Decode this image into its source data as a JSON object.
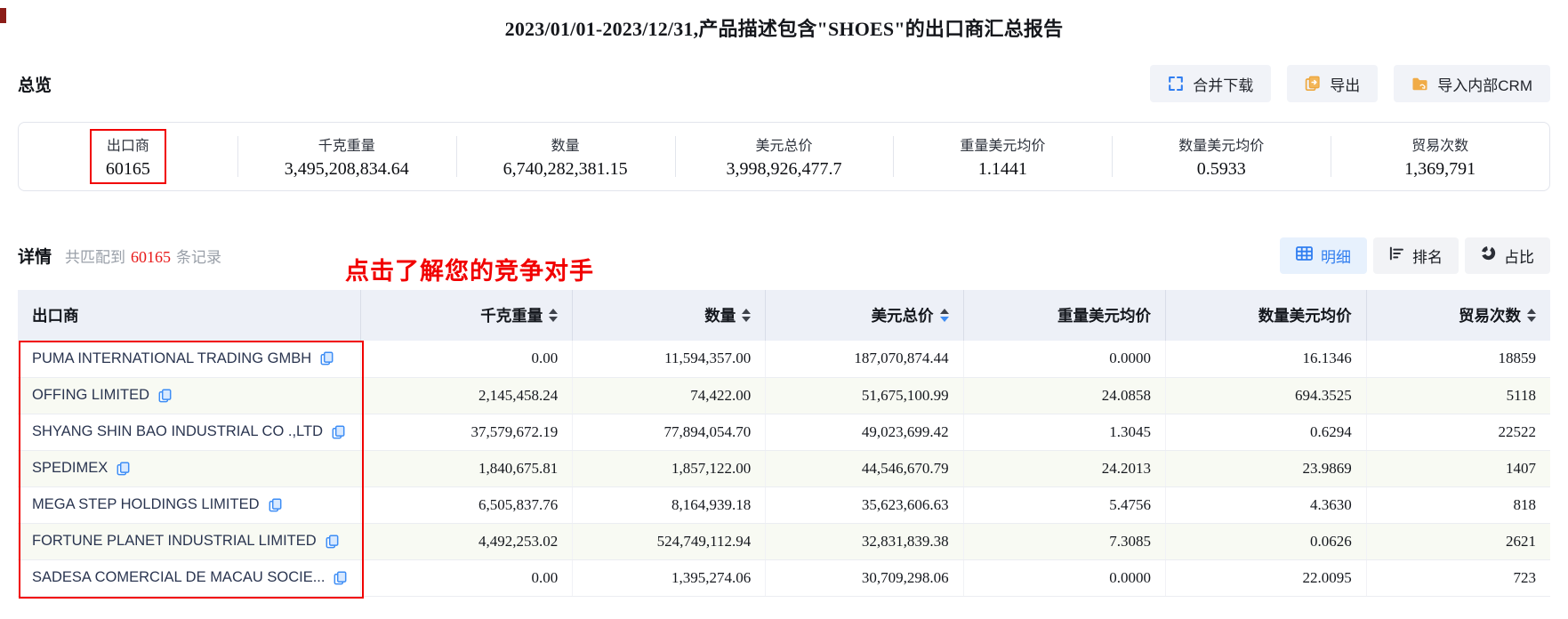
{
  "title": "2023/01/01-2023/12/31,产品描述包含\"SHOES\"的出口商汇总报告",
  "overview": {
    "heading": "总览",
    "actions": [
      {
        "label": "合并下载",
        "icon": "merge-download-icon"
      },
      {
        "label": "导出",
        "icon": "export-icon"
      },
      {
        "label": "导入内部CRM",
        "icon": "import-crm-icon"
      }
    ],
    "stats": [
      {
        "label": "出口商",
        "value": "60165",
        "highlighted": true
      },
      {
        "label": "千克重量",
        "value": "3,495,208,834.64",
        "highlighted": false
      },
      {
        "label": "数量",
        "value": "6,740,282,381.15",
        "highlighted": false
      },
      {
        "label": "美元总价",
        "value": "3,998,926,477.7",
        "highlighted": false
      },
      {
        "label": "重量美元均价",
        "value": "1.1441",
        "highlighted": false
      },
      {
        "label": "数量美元均价",
        "value": "0.5933",
        "highlighted": false
      },
      {
        "label": "贸易次数",
        "value": "1,369,791",
        "highlighted": false
      }
    ]
  },
  "detail": {
    "heading": "详情",
    "match_prefix": "共匹配到",
    "match_count": "60165",
    "match_suffix": "条记录",
    "annotation": "点击了解您的竞争对手",
    "views": [
      {
        "label": "明细",
        "icon": "table-grid-icon",
        "active": true
      },
      {
        "label": "排名",
        "icon": "ranking-bars-icon",
        "active": false
      },
      {
        "label": "占比",
        "icon": "donut-chart-icon",
        "active": false
      }
    ]
  },
  "table": {
    "copy_icon": "copy-icon",
    "columns": [
      {
        "label": "出口商",
        "align": "left",
        "sortable": false,
        "active_sort": null
      },
      {
        "label": "千克重量",
        "align": "right",
        "sortable": true,
        "active_sort": null
      },
      {
        "label": "数量",
        "align": "right",
        "sortable": true,
        "active_sort": null
      },
      {
        "label": "美元总价",
        "align": "right",
        "sortable": true,
        "active_sort": "desc"
      },
      {
        "label": "重量美元均价",
        "align": "right",
        "sortable": false,
        "active_sort": null
      },
      {
        "label": "数量美元均价",
        "align": "right",
        "sortable": false,
        "active_sort": null
      },
      {
        "label": "贸易次数",
        "align": "right",
        "sortable": true,
        "active_sort": null
      }
    ],
    "rows": [
      {
        "exporter": "PUMA INTERNATIONAL TRADING GMBH",
        "values": [
          "0.00",
          "11,594,357.00",
          "187,070,874.44",
          "0.0000",
          "16.1346",
          "18859"
        ]
      },
      {
        "exporter": "OFFING LIMITED",
        "values": [
          "2,145,458.24",
          "74,422.00",
          "51,675,100.99",
          "24.0858",
          "694.3525",
          "5118"
        ]
      },
      {
        "exporter": "SHYANG SHIN BAO INDUSTRIAL CO .,LTD",
        "values": [
          "37,579,672.19",
          "77,894,054.70",
          "49,023,699.42",
          "1.3045",
          "0.6294",
          "22522"
        ]
      },
      {
        "exporter": "SPEDIMEX",
        "values": [
          "1,840,675.81",
          "1,857,122.00",
          "44,546,670.79",
          "24.2013",
          "23.9869",
          "1407"
        ]
      },
      {
        "exporter": "MEGA STEP HOLDINGS LIMITED",
        "values": [
          "6,505,837.76",
          "8,164,939.18",
          "35,623,606.63",
          "5.4756",
          "4.3630",
          "818"
        ]
      },
      {
        "exporter": "FORTUNE PLANET INDUSTRIAL LIMITED",
        "values": [
          "4,492,253.02",
          "524,749,112.94",
          "32,831,839.38",
          "7.3085",
          "0.0626",
          "2621"
        ]
      },
      {
        "exporter": "SADESA COMERCIAL DE MACAU SOCIE...",
        "values": [
          "0.00",
          "1,395,274.06",
          "30,709,298.06",
          "0.0000",
          "22.0095",
          "723"
        ]
      }
    ]
  },
  "colors": {
    "annotation_red": "#f10000",
    "count_red": "#e81818",
    "accent_blue": "#2f7df0",
    "accent_orange": "#eda73e",
    "header_bg": "#edf0f7",
    "stripe_bg": "#f8faf3",
    "button_bg": "#f1f3f8"
  }
}
